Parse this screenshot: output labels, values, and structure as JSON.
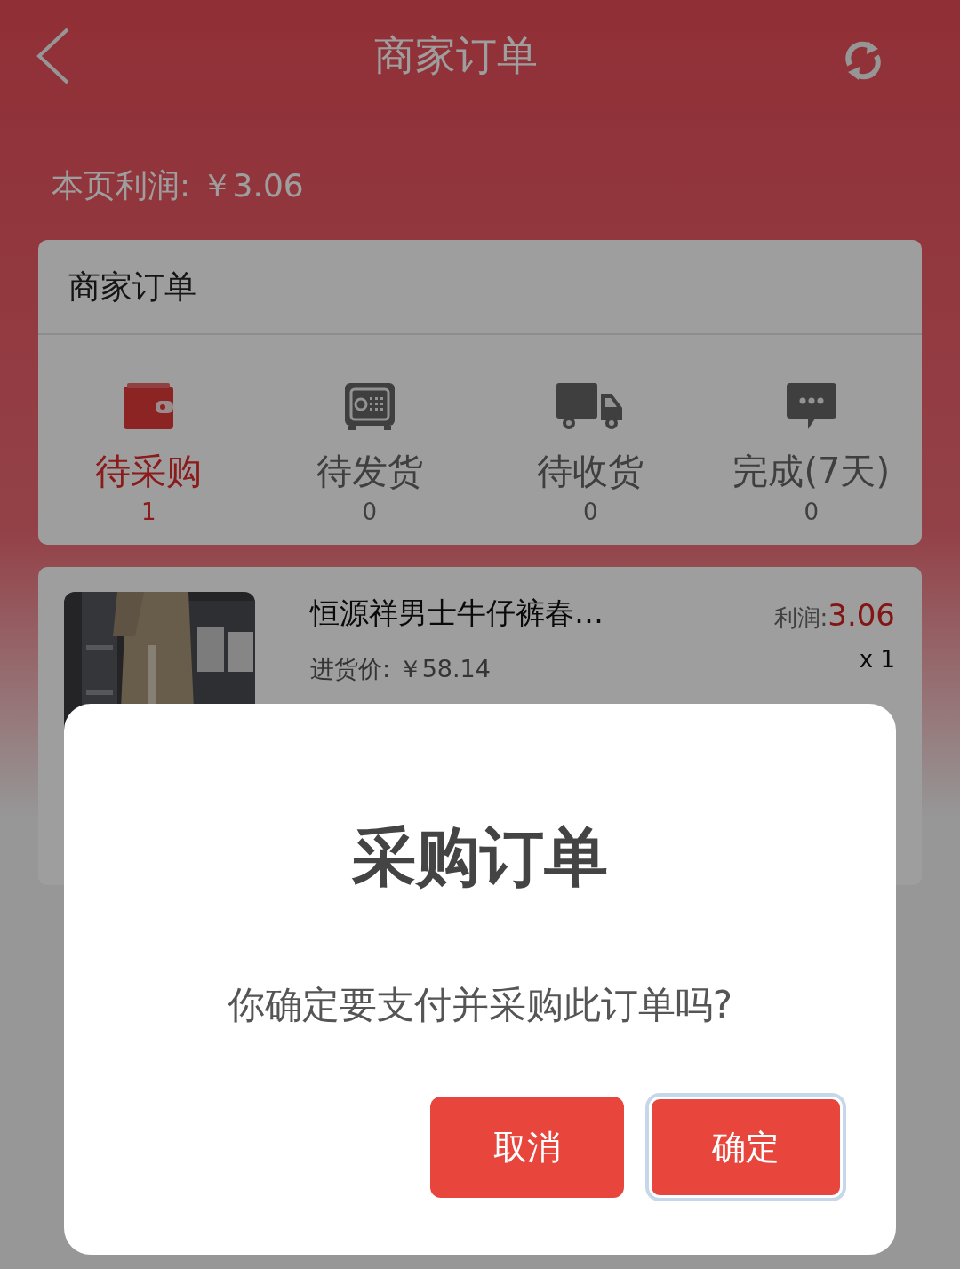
{
  "header": {
    "title": "商家订单"
  },
  "page_profit": "本页利润: ￥3.06",
  "orders_panel": {
    "title": "商家订单",
    "tabs": [
      {
        "kind": "wallet",
        "label": "待采购",
        "count": "1",
        "selected": true
      },
      {
        "kind": "safe",
        "label": "待发货",
        "count": "0",
        "selected": false
      },
      {
        "kind": "truck",
        "label": "待收货",
        "count": "0",
        "selected": false
      },
      {
        "kind": "chat",
        "label": "完成(7天)",
        "count": "0",
        "selected": false
      }
    ]
  },
  "order": {
    "title": "恒源祥男士牛仔裤春…",
    "cost": "进货价: ￥58.14",
    "profit_label": "利润:",
    "profit": "3.06",
    "quantity": "x 1"
  },
  "dialog": {
    "title": "采购订单",
    "message": "你确定要支付并采购此订单吗?",
    "buttons": [
      {
        "label": "取消",
        "focused": false
      },
      {
        "label": "确定",
        "focused": true
      }
    ]
  }
}
